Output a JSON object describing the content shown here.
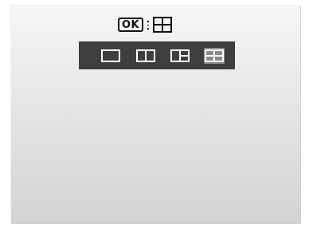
{
  "screen": {
    "ok_hint": {
      "key_label": "OK",
      "key_icon": "ok-key-icon",
      "separator_icon": "colon-separator-icon",
      "current_layout_icon": "layout-quad-icon"
    },
    "layout_options": [
      {
        "id": "single",
        "icon": "layout-single-icon",
        "selected": false
      },
      {
        "id": "split-vertical",
        "icon": "layout-split-icon",
        "selected": false
      },
      {
        "id": "split-right-horizontal",
        "icon": "layout-three-icon",
        "selected": false
      },
      {
        "id": "quad",
        "icon": "layout-quad-icon",
        "selected": true
      }
    ],
    "colors": {
      "bar_bg": "#3e3e3e",
      "icon_white": "#ffffff",
      "selected_bg": "#8c8c8c",
      "text_dark": "#111111"
    }
  }
}
